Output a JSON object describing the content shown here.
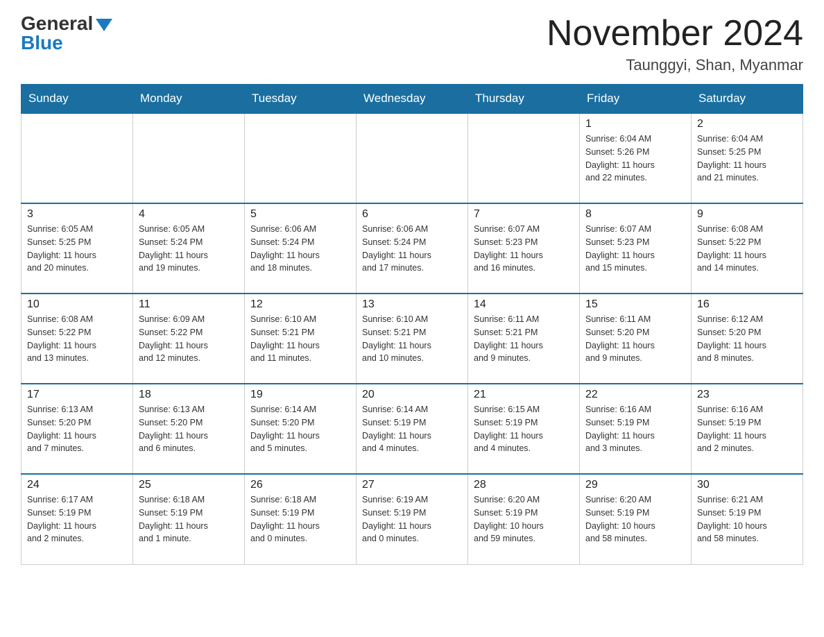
{
  "logo": {
    "general": "General",
    "blue": "Blue"
  },
  "title": "November 2024",
  "location": "Taunggyi, Shan, Myanmar",
  "days_of_week": [
    "Sunday",
    "Monday",
    "Tuesday",
    "Wednesday",
    "Thursday",
    "Friday",
    "Saturday"
  ],
  "weeks": [
    [
      {
        "day": "",
        "info": ""
      },
      {
        "day": "",
        "info": ""
      },
      {
        "day": "",
        "info": ""
      },
      {
        "day": "",
        "info": ""
      },
      {
        "day": "",
        "info": ""
      },
      {
        "day": "1",
        "info": "Sunrise: 6:04 AM\nSunset: 5:26 PM\nDaylight: 11 hours\nand 22 minutes."
      },
      {
        "day": "2",
        "info": "Sunrise: 6:04 AM\nSunset: 5:25 PM\nDaylight: 11 hours\nand 21 minutes."
      }
    ],
    [
      {
        "day": "3",
        "info": "Sunrise: 6:05 AM\nSunset: 5:25 PM\nDaylight: 11 hours\nand 20 minutes."
      },
      {
        "day": "4",
        "info": "Sunrise: 6:05 AM\nSunset: 5:24 PM\nDaylight: 11 hours\nand 19 minutes."
      },
      {
        "day": "5",
        "info": "Sunrise: 6:06 AM\nSunset: 5:24 PM\nDaylight: 11 hours\nand 18 minutes."
      },
      {
        "day": "6",
        "info": "Sunrise: 6:06 AM\nSunset: 5:24 PM\nDaylight: 11 hours\nand 17 minutes."
      },
      {
        "day": "7",
        "info": "Sunrise: 6:07 AM\nSunset: 5:23 PM\nDaylight: 11 hours\nand 16 minutes."
      },
      {
        "day": "8",
        "info": "Sunrise: 6:07 AM\nSunset: 5:23 PM\nDaylight: 11 hours\nand 15 minutes."
      },
      {
        "day": "9",
        "info": "Sunrise: 6:08 AM\nSunset: 5:22 PM\nDaylight: 11 hours\nand 14 minutes."
      }
    ],
    [
      {
        "day": "10",
        "info": "Sunrise: 6:08 AM\nSunset: 5:22 PM\nDaylight: 11 hours\nand 13 minutes."
      },
      {
        "day": "11",
        "info": "Sunrise: 6:09 AM\nSunset: 5:22 PM\nDaylight: 11 hours\nand 12 minutes."
      },
      {
        "day": "12",
        "info": "Sunrise: 6:10 AM\nSunset: 5:21 PM\nDaylight: 11 hours\nand 11 minutes."
      },
      {
        "day": "13",
        "info": "Sunrise: 6:10 AM\nSunset: 5:21 PM\nDaylight: 11 hours\nand 10 minutes."
      },
      {
        "day": "14",
        "info": "Sunrise: 6:11 AM\nSunset: 5:21 PM\nDaylight: 11 hours\nand 9 minutes."
      },
      {
        "day": "15",
        "info": "Sunrise: 6:11 AM\nSunset: 5:20 PM\nDaylight: 11 hours\nand 9 minutes."
      },
      {
        "day": "16",
        "info": "Sunrise: 6:12 AM\nSunset: 5:20 PM\nDaylight: 11 hours\nand 8 minutes."
      }
    ],
    [
      {
        "day": "17",
        "info": "Sunrise: 6:13 AM\nSunset: 5:20 PM\nDaylight: 11 hours\nand 7 minutes."
      },
      {
        "day": "18",
        "info": "Sunrise: 6:13 AM\nSunset: 5:20 PM\nDaylight: 11 hours\nand 6 minutes."
      },
      {
        "day": "19",
        "info": "Sunrise: 6:14 AM\nSunset: 5:20 PM\nDaylight: 11 hours\nand 5 minutes."
      },
      {
        "day": "20",
        "info": "Sunrise: 6:14 AM\nSunset: 5:19 PM\nDaylight: 11 hours\nand 4 minutes."
      },
      {
        "day": "21",
        "info": "Sunrise: 6:15 AM\nSunset: 5:19 PM\nDaylight: 11 hours\nand 4 minutes."
      },
      {
        "day": "22",
        "info": "Sunrise: 6:16 AM\nSunset: 5:19 PM\nDaylight: 11 hours\nand 3 minutes."
      },
      {
        "day": "23",
        "info": "Sunrise: 6:16 AM\nSunset: 5:19 PM\nDaylight: 11 hours\nand 2 minutes."
      }
    ],
    [
      {
        "day": "24",
        "info": "Sunrise: 6:17 AM\nSunset: 5:19 PM\nDaylight: 11 hours\nand 2 minutes."
      },
      {
        "day": "25",
        "info": "Sunrise: 6:18 AM\nSunset: 5:19 PM\nDaylight: 11 hours\nand 1 minute."
      },
      {
        "day": "26",
        "info": "Sunrise: 6:18 AM\nSunset: 5:19 PM\nDaylight: 11 hours\nand 0 minutes."
      },
      {
        "day": "27",
        "info": "Sunrise: 6:19 AM\nSunset: 5:19 PM\nDaylight: 11 hours\nand 0 minutes."
      },
      {
        "day": "28",
        "info": "Sunrise: 6:20 AM\nSunset: 5:19 PM\nDaylight: 10 hours\nand 59 minutes."
      },
      {
        "day": "29",
        "info": "Sunrise: 6:20 AM\nSunset: 5:19 PM\nDaylight: 10 hours\nand 58 minutes."
      },
      {
        "day": "30",
        "info": "Sunrise: 6:21 AM\nSunset: 5:19 PM\nDaylight: 10 hours\nand 58 minutes."
      }
    ]
  ]
}
